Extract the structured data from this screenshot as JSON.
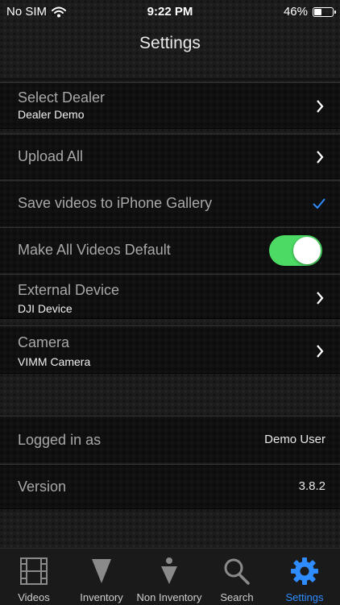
{
  "status": {
    "carrier": "No SIM",
    "time": "9:22 PM",
    "battery": "46%",
    "battery_level": 0.46
  },
  "nav": {
    "title": "Settings"
  },
  "rows": {
    "dealer": {
      "label": "Select Dealer",
      "sub": "Dealer Demo"
    },
    "upload": {
      "label": "Upload All"
    },
    "save": {
      "label": "Save videos to iPhone Gallery",
      "checked": true
    },
    "default": {
      "label": "Make All Videos Default",
      "on": true
    },
    "external": {
      "label": "External Device",
      "sub": "DJI Device"
    },
    "camera": {
      "label": "Camera",
      "sub": "VIMM Camera"
    },
    "logged": {
      "label": "Logged in as",
      "value": "Demo User"
    },
    "version": {
      "label": "Version",
      "value": "3.8.2"
    }
  },
  "tabs": [
    {
      "label": "Videos",
      "icon": "film-icon"
    },
    {
      "label": "Inventory",
      "icon": "inventory-icon"
    },
    {
      "label": "Non Inventory",
      "icon": "non-inventory-icon"
    },
    {
      "label": "Search",
      "icon": "search-icon"
    },
    {
      "label": "Settings",
      "icon": "gear-icon",
      "active": true
    }
  ],
  "colors": {
    "accent": "#2f8cff",
    "toggle_on": "#4cd964"
  }
}
